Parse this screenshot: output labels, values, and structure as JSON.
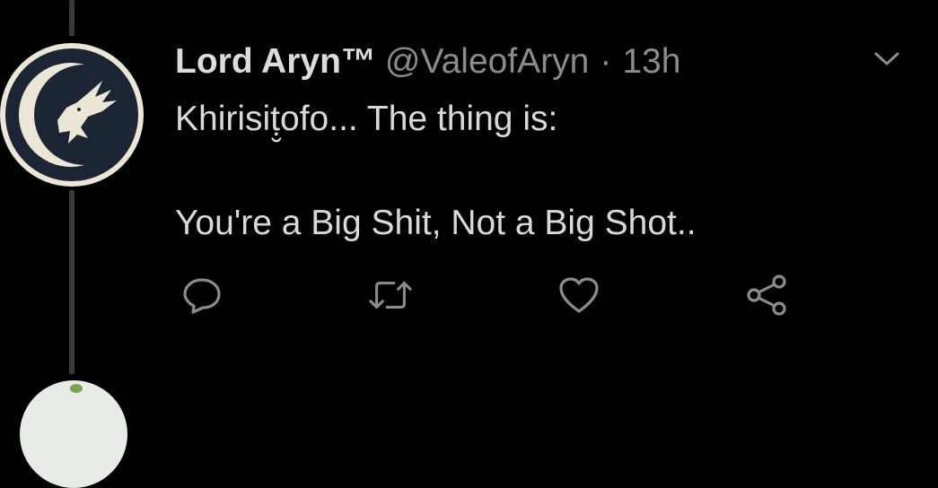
{
  "tweet": {
    "display_name": "Lord Aryn™",
    "handle": "@ValeofAryn",
    "separator": "·",
    "time": "13h",
    "text_line_1": "Khirisiṭ̮ofo... The thing is:",
    "text_line_2": "You're a Big Shit, Not a Big Shot.."
  },
  "icons": {
    "avatar": "falcon-crest-icon",
    "caret": "chevron-down-icon",
    "reply": "reply-icon",
    "retweet": "retweet-icon",
    "like": "heart-icon",
    "share": "share-icon"
  },
  "colors": {
    "background": "#000000",
    "primary_text": "#d9d9d9",
    "secondary_text": "#8b8b8b",
    "icon": "#8b8b8b",
    "thread_line": "#3a3a3a",
    "avatar_bg": "#ebe6d6",
    "avatar_dark": "#1b2533"
  }
}
